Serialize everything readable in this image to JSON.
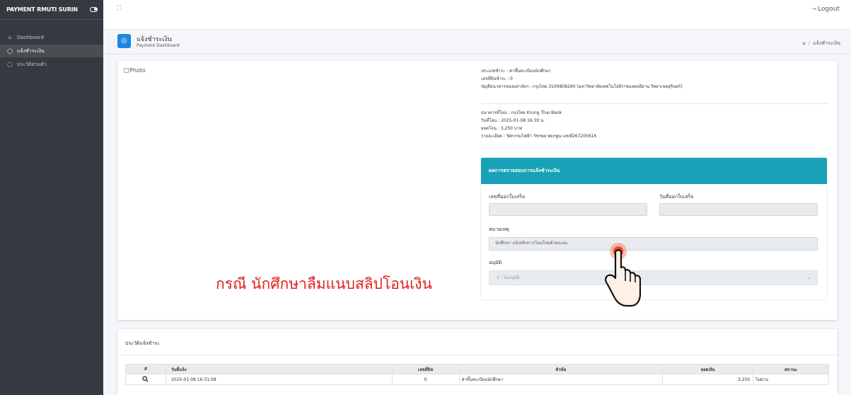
{
  "sidebar": {
    "brand": "PAYMENT RMUTI SURIN",
    "items": [
      {
        "label": "Dashboard",
        "icon": "home-icon"
      },
      {
        "label": "แจ้งชำระเงิน",
        "icon": "shield-icon"
      },
      {
        "label": "ประวัติส่วนตัว",
        "icon": "shield-icon"
      }
    ]
  },
  "topbar": {
    "logout_label": "Logout"
  },
  "header": {
    "title": "แจ้งชำระเงิน",
    "subtitle": "Payment Dashboard",
    "breadcrumb_current": "แจ้งชำระเงิน"
  },
  "photo_alt": "Photo",
  "payment_info": {
    "type": "ประเภทชำระ : ค่าขึ้นทะเบียนนักศึกษา",
    "bill_no": "เลขที่บิลชำระ : 0",
    "account": "บัญชีธนาคารของมหาลัยฯ : กรุงไทย 3100808290 (มหาวิทยาลัยเทคโนโลยีราชมงคลอีสาน วิทยาเขตสุรินทร์)"
  },
  "transfer_info": {
    "bank": "ธนาคารที่โอน : กรุงไทย Krung Thai Bank",
    "date": "วันที่โอน : 2025-01-08 16:30 น.",
    "amount": "ยอดโอน : 3,250 บาท",
    "detail": "รายละเอียด : วิศกรรมไฟฟ้า วัชรพล พยกพูน เลขที่267205616"
  },
  "verify": {
    "header": "ผลการตรวจสอบการแจ้งชำระเงิน",
    "receipt_no_label": "เลขที่ออกใบเสร็จ",
    "receipt_no_value": "",
    "receipt_date_label": "วันที่ออกใบเสร็จ",
    "receipt_date_value": "",
    "note_label": "หมายเหตุ",
    "note_value": "นักศึกษา แจ้งสลิปการโอนใหม่ด้วยนะคะ",
    "approve_label": "อนุมัติ",
    "approve_value": "2 : ไม่อนุมัติ"
  },
  "annotation": "กรณี นักศึกษาลืมแนบสลิปโอนเงิน",
  "history": {
    "title": "ประวัติแจ้งชำระ",
    "columns": [
      "#",
      "วันที่แจ้ง",
      "เลขที่บิล",
      "หัวข้อ",
      "ยอดเงิน",
      "สถานะ"
    ],
    "rows": [
      {
        "date": "2025-01-08 16:31:08",
        "bill": "0",
        "topic": "ค่าขึ้นทะเบียนนักศึกษา",
        "amount": "3,250",
        "status": "ไม่ผ่าน"
      }
    ]
  },
  "colors": {
    "sidebar": "#343a40",
    "accent": "#17a2b8",
    "header_icon": "#1a87e0",
    "annotation": "#e0201b",
    "status_fail": "#dc3545"
  }
}
